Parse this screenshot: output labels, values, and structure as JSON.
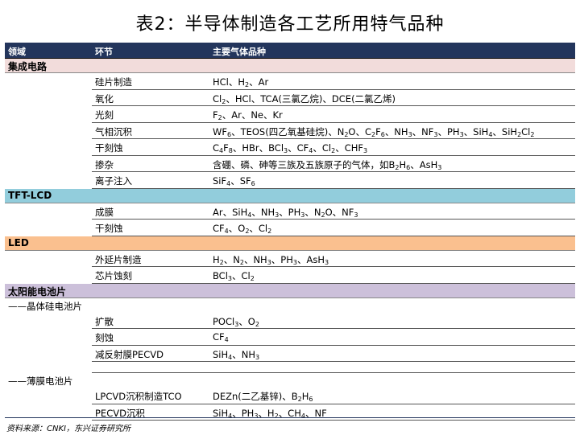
{
  "title": "表2：半导体制造各工艺所用特气品种",
  "header": {
    "col1": "领域",
    "col2": "环节",
    "col3": "主要气体品种"
  },
  "sections": [
    {
      "name": "集成电路",
      "rows": [
        {
          "process": "硅片制造",
          "gas": "HCl、H<sub>2</sub>、Ar"
        },
        {
          "process": "氧化",
          "gas": "Cl<sub>2</sub>、HCl、TCA(三氯乙烷)、DCE(二氯乙烯)"
        },
        {
          "process": "光刻",
          "gas": "F<sub>2</sub>、Ar、Ne、Kr"
        },
        {
          "process": "气相沉积",
          "gas": "WF<sub>6</sub>、TEOS(四乙氧基硅烷)、N<sub>2</sub>O、C<sub>2</sub>F<sub>6</sub>、NH<sub>3</sub>、NF<sub>3</sub>、PH<sub>3</sub>、SiH<sub>4</sub>、SiH<sub>2</sub>Cl<sub>2</sub>"
        },
        {
          "process": "干刻蚀",
          "gas": "C<sub>4</sub>F<sub>8</sub>、HBr、BCl<sub>3</sub>、CF<sub>4</sub>、Cl<sub>2</sub>、CHF<sub>3</sub>"
        },
        {
          "process": "掺杂",
          "gas": "含硼、磷、砷等三族及五族原子的气体，如B<sub>2</sub>H<sub>6</sub>、AsH<sub>3</sub>"
        },
        {
          "process": "离子注入",
          "gas": "SiF<sub>4</sub>、SF<sub>6</sub>"
        }
      ]
    },
    {
      "name": "TFT-LCD",
      "rows": [
        {
          "process": "成膜",
          "gas": "Ar、SiH<sub>4</sub>、NH<sub>3</sub>、PH<sub>3</sub>、N<sub>2</sub>O、NF<sub>3</sub>"
        },
        {
          "process": "干刻蚀",
          "gas": "CF<sub>4</sub>、O<sub>2</sub>、Cl<sub>2</sub>"
        }
      ]
    },
    {
      "name": "LED",
      "rows": [
        {
          "process": "外延片制造",
          "gas": "H<sub>2</sub>、N<sub>2</sub>、NH<sub>3</sub>、PH<sub>3</sub>、AsH<sub>3</sub>"
        },
        {
          "process": "芯片蚀刻",
          "gas": "BCl<sub>3</sub>、Cl<sub>2</sub>"
        }
      ]
    }
  ],
  "solar": {
    "name": "太阳能电池片",
    "crystal_label": "——晶体硅电池片",
    "crystal_rows": [
      {
        "process": "扩散",
        "gas": "POCl<sub>3</sub>、O<sub>2</sub>"
      },
      {
        "process": "刻蚀",
        "gas": "CF<sub>4</sub>"
      },
      {
        "process": "减反射膜PECVD",
        "gas": "SiH<sub>4</sub>、NH<sub>3</sub>"
      }
    ],
    "thin_label": "——薄膜电池片",
    "thin_rows": [
      {
        "process": "LPCVD沉积制造TCO",
        "gas": "DEZn(二乙基锌)、B<sub>2</sub>H<sub>6</sub>"
      },
      {
        "process": "PECVD沉积",
        "gas": "SiH<sub>4</sub>、PH<sub>3</sub>、H<sub>2</sub>、CH<sub>4</sub>、NF"
      }
    ]
  },
  "source": "资料来源：CNKI，东兴证券研究所",
  "colors": {
    "header_bg": "#23355c",
    "ic": "#f2dcdb",
    "tft": "#92cddc",
    "led": "#fac08f",
    "solar": "#ccc0da"
  }
}
